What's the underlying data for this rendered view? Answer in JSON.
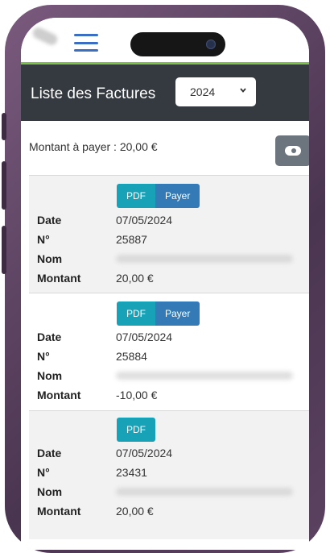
{
  "header": {
    "title": "Liste des Factures",
    "year_selected": "2024"
  },
  "summary": {
    "amount_text": "Montant à payer :  20,00 €"
  },
  "labels": {
    "date": "Date",
    "number": "N°",
    "name": "Nom",
    "amount": "Montant"
  },
  "buttons": {
    "pdf": "PDF",
    "pay": "Payer"
  },
  "invoices": [
    {
      "date": "07/05/2024",
      "number": "25887",
      "amount": "20,00 €"
    },
    {
      "date": "07/05/2024",
      "number": "25884",
      "amount": "-10,00 €"
    },
    {
      "date": "07/05/2024",
      "number": "23431",
      "amount": "20,00 €"
    }
  ],
  "icons": {
    "menu": "hamburger-menu-icon",
    "select": "chevron-down-icon",
    "toggle": "toggle-icon"
  },
  "colors": {
    "header_bg": "#343a40",
    "accent_green": "#7cc14a",
    "pdf": "#17a2b8",
    "pay": "#337ab7",
    "toggle": "#6c757d"
  }
}
